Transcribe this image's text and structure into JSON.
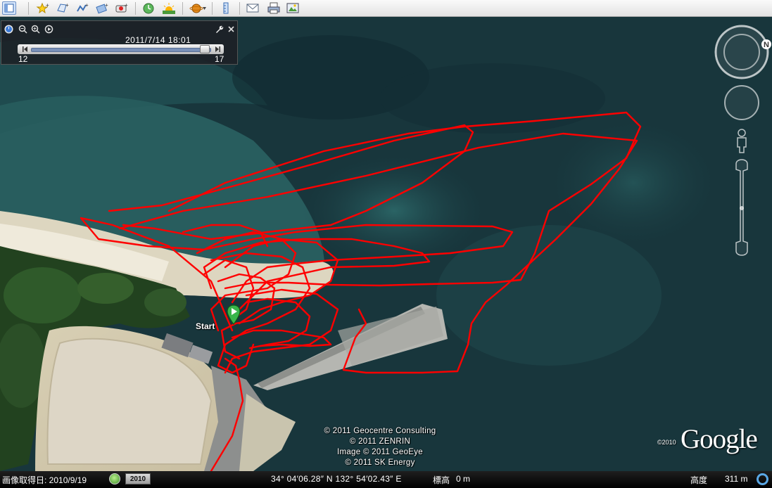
{
  "toolbar": {
    "buttons": [
      {
        "name": "sidebar-toggle-button",
        "icon": "sidebar-icon"
      },
      {
        "name": "add-placemark-button",
        "icon": "placemark-star-icon"
      },
      {
        "name": "add-polygon-button",
        "icon": "polygon-icon"
      },
      {
        "name": "add-path-button",
        "icon": "path-icon"
      },
      {
        "name": "add-image-overlay-button",
        "icon": "image-overlay-icon"
      },
      {
        "name": "record-tour-button",
        "icon": "record-tour-icon"
      },
      {
        "name": "historical-imagery-button",
        "icon": "historical-clock-icon"
      },
      {
        "name": "sunlight-button",
        "icon": "sunlight-icon"
      },
      {
        "name": "switch-planet-button",
        "icon": "planet-icon"
      },
      {
        "name": "ruler-button",
        "icon": "ruler-icon"
      },
      {
        "name": "email-button",
        "icon": "email-icon"
      },
      {
        "name": "print-button",
        "icon": "print-icon"
      },
      {
        "name": "save-image-button",
        "icon": "save-image-icon"
      }
    ]
  },
  "time_slider": {
    "current_time": "2011/7/14  18:01",
    "range_start": "12",
    "range_end": "17"
  },
  "map": {
    "start_label": "Start",
    "track_color": "#ff0000",
    "copyright": [
      "© 2011 Geocentre Consulting",
      "© 2011 ZENRIN",
      "Image © 2011 GeoEye",
      "© 2011 SK Energy"
    ],
    "logo_year": "©2010",
    "logo_text": "Google",
    "compass_north": "N"
  },
  "status_bar": {
    "imagery_date": "画像取得日: 2010/9/19",
    "imagery_year": "2010",
    "coordinates": "34° 04′06.28″ N 132° 54′02.43″ E",
    "elevation_label": "標高",
    "elevation_value": "0 m",
    "altitude_label": "高度",
    "altitude_value": "311 m"
  }
}
